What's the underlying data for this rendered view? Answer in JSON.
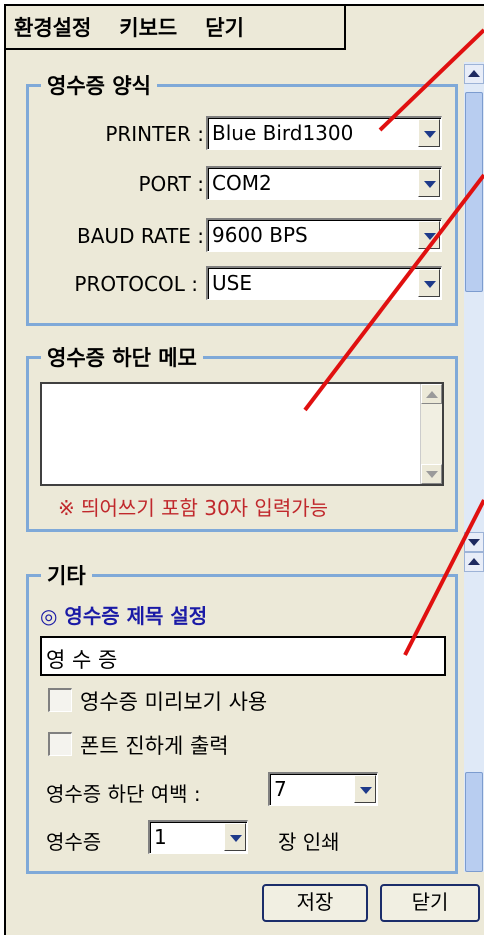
{
  "menu": {
    "items": [
      "환경설정",
      "키보드",
      "닫기"
    ]
  },
  "receipt_format": {
    "title": "영수증 양식",
    "fields": [
      {
        "label": "PRINTER :",
        "value": "Blue Bird1300"
      },
      {
        "label": "PORT :",
        "value": "COM2"
      },
      {
        "label": "BAUD RATE :",
        "value": "9600 BPS"
      },
      {
        "label": "PROTOCOL :",
        "value": "USE"
      }
    ]
  },
  "footer_memo": {
    "title": "영수증 하단 메모",
    "value": "",
    "note": "※ 띄어쓰기 포함 30자 입력가능"
  },
  "etc": {
    "title": "기타",
    "subtitle": "◎ 영수증 제목 설정",
    "receipt_title_value": "영 수 증",
    "checkboxes": [
      {
        "label": "영수증 미리보기 사용",
        "checked": false
      },
      {
        "label": "폰트 진하게 출력",
        "checked": false
      }
    ],
    "bottom_margin": {
      "label": "영수증 하단 여백 :",
      "value": "7"
    },
    "copies": {
      "prefix": "영수증",
      "value": "1",
      "suffix": "장 인쇄"
    }
  },
  "buttons": {
    "save": "저장",
    "close": "닫기"
  },
  "colors": {
    "annotation": "#e01010",
    "group_border": "#7fa9d8",
    "note_red": "#c0282c",
    "subtitle_blue": "#1a1aa6"
  }
}
